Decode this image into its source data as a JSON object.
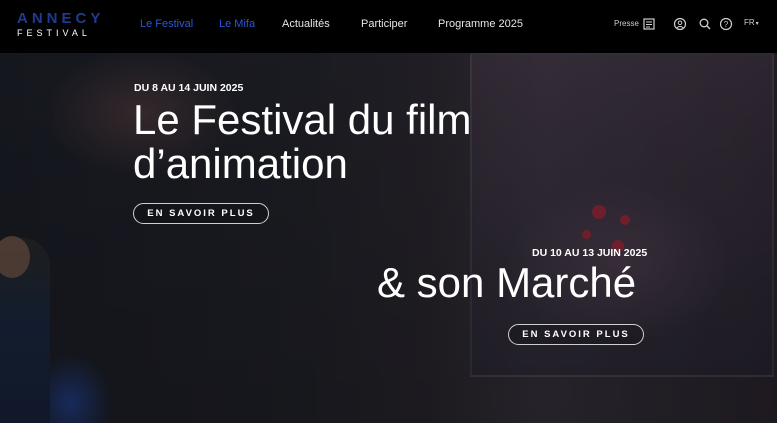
{
  "header": {
    "logo": {
      "word": "ANNECY",
      "sub": "FESTIVAL"
    },
    "nav": [
      {
        "label": "Le Festival",
        "active": true
      },
      {
        "label": "Le Mifa",
        "active": true
      },
      {
        "label": "Actualités",
        "active": false
      },
      {
        "label": "Participer",
        "active": false
      },
      {
        "label": "Programme 2025",
        "active": false
      }
    ],
    "utility": {
      "presse_label": "Presse",
      "icons": [
        "press-icon",
        "account-icon",
        "search-icon",
        "help-icon"
      ],
      "language": "FR"
    }
  },
  "hero": {
    "festival": {
      "dates": "DU 8 AU 14 JUIN 2025",
      "title_line1": "Le Festival du film",
      "title_line2": "d’animation",
      "cta": "EN SAVOIR PLUS"
    },
    "market": {
      "dates": "DU 10 AU 13 JUIN 2025",
      "title": "& son Marché",
      "cta": "EN SAVOIR PLUS"
    }
  },
  "colors": {
    "accent": "#2b57d6",
    "logo_blue": "#1f3b8f",
    "background": "#000000"
  }
}
